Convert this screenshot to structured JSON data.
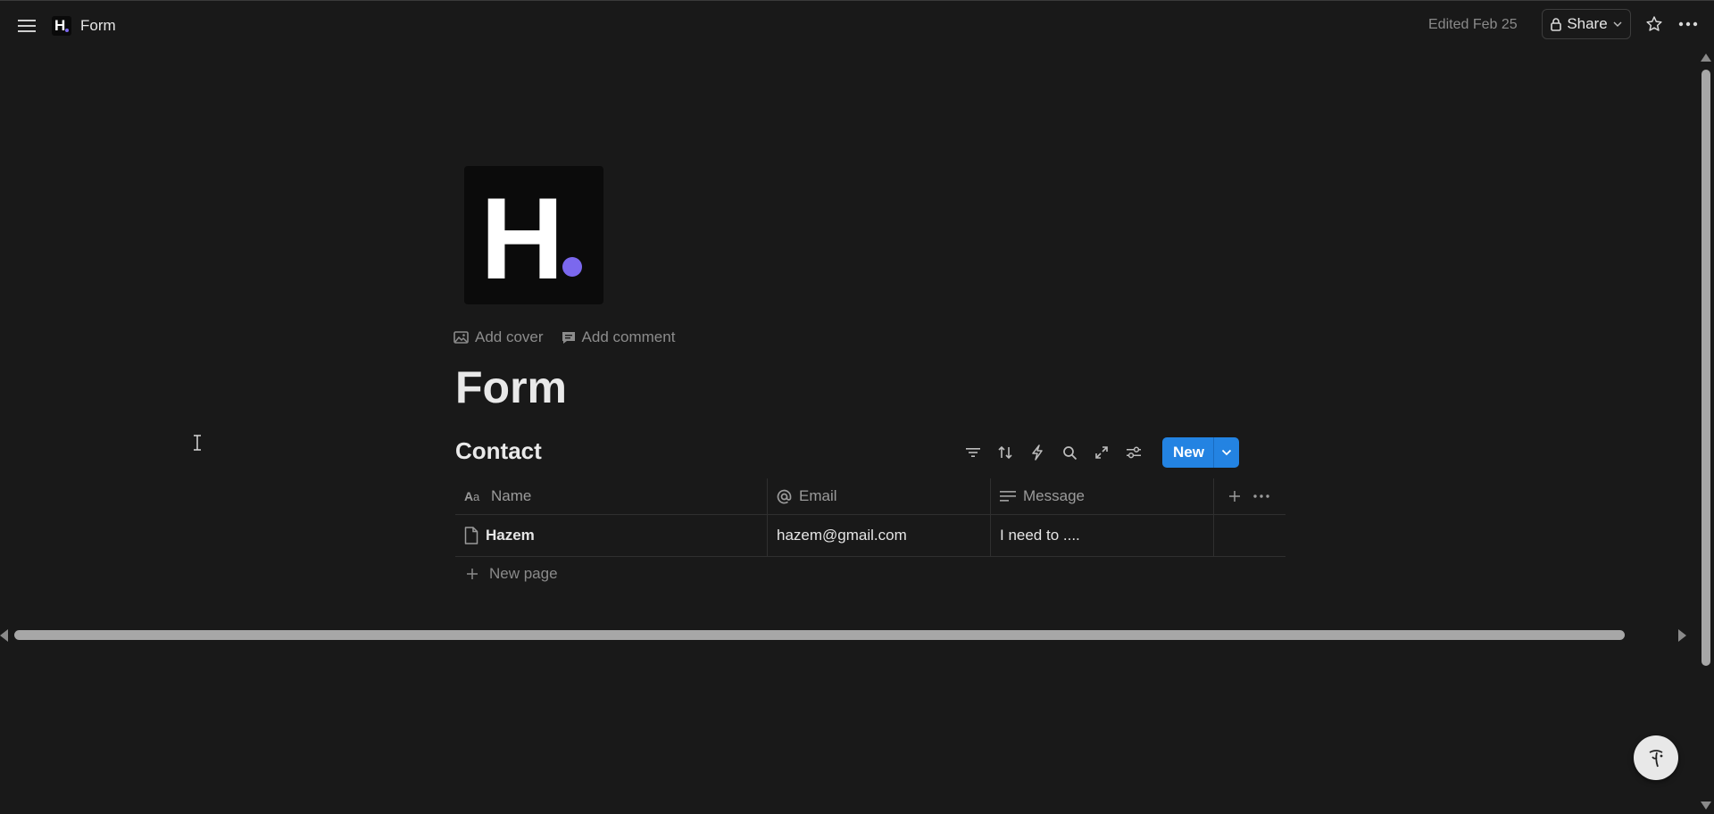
{
  "topbar": {
    "breadcrumb_logo_letter": "H",
    "breadcrumb_title": "Form",
    "edited": "Edited Feb 25",
    "share_label": "Share"
  },
  "page": {
    "icon_letter": "H",
    "add_cover": "Add cover",
    "add_comment": "Add comment",
    "title": "Form"
  },
  "database": {
    "title": "Contact",
    "new_label": "New",
    "columns": [
      {
        "label": "Name",
        "icon": "text-type-icon"
      },
      {
        "label": "Email",
        "icon": "at-sign-icon"
      },
      {
        "label": "Message",
        "icon": "text-lines-icon"
      }
    ],
    "rows": [
      {
        "name": "Hazem",
        "email": "hazem@gmail.com",
        "message": "I need to ...."
      }
    ],
    "new_page": "New page"
  },
  "colors": {
    "background": "#191919",
    "accent": "#2383e2",
    "logo_dot": "#7b68ee"
  }
}
